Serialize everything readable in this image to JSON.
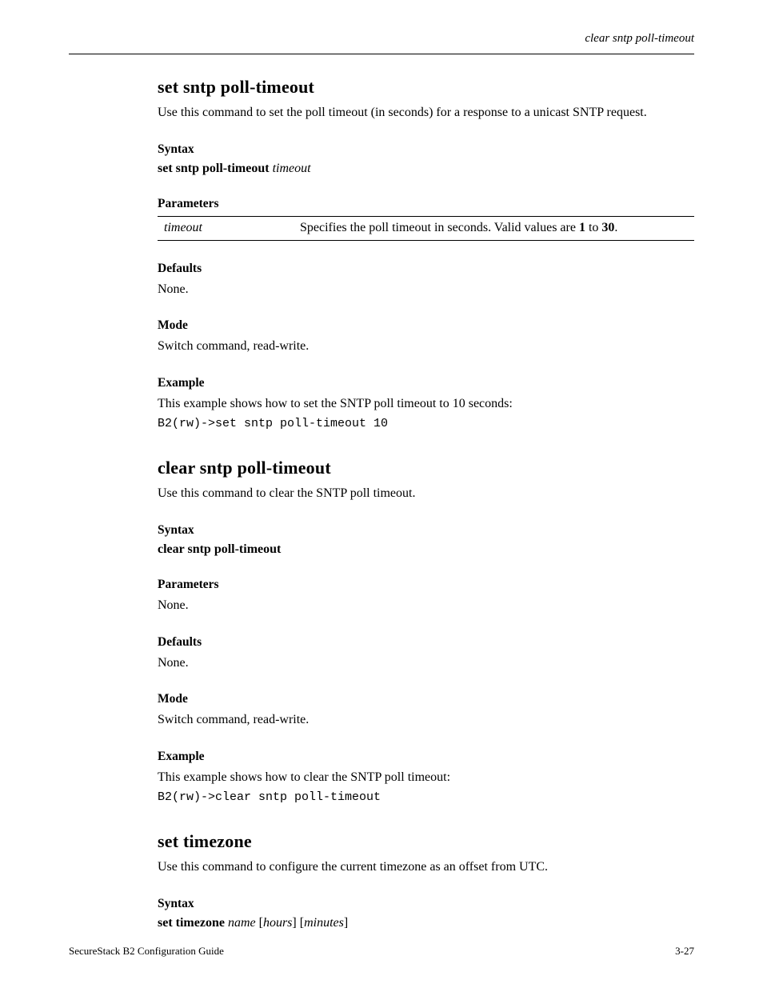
{
  "header": {
    "right": "clear sntp poll-timeout"
  },
  "sec1": {
    "title": "set sntp poll-timeout",
    "intro": "Use this command to set the poll timeout (in seconds) for a response to a unicast SNTP request.",
    "syntax_h": "Syntax",
    "syntax_cmd": "set sntp poll-timeout",
    "syntax_arg": "timeout",
    "params_h": "Parameters",
    "param_name": "timeout",
    "param_desc_pre": "Specifies the poll timeout in seconds. Valid values are ",
    "param_desc_b1": "1",
    "param_desc_mid": " to ",
    "param_desc_b2": "30",
    "param_desc_post": ".",
    "defaults_h": "Defaults",
    "defaults_v": "None.",
    "mode_h": "Mode",
    "mode_v": "Switch command, read‑write.",
    "example_h": "Example",
    "example_text": "This example shows how to set the SNTP poll timeout to 10 seconds:",
    "example_code": "B2(rw)->set sntp poll-timeout 10"
  },
  "sec2": {
    "title": "clear sntp poll-timeout",
    "intro": "Use this command to clear the SNTP poll timeout.",
    "syntax_h": "Syntax",
    "syntax_cmd": "clear sntp poll-timeout",
    "params_h": "Parameters",
    "params_v": "None.",
    "defaults_h": "Defaults",
    "defaults_v": "None.",
    "mode_h": "Mode",
    "mode_v": "Switch command, read‑write.",
    "example_h": "Example",
    "example_text": "This example shows how to clear the SNTP poll timeout:",
    "example_code": "B2(rw)->clear sntp poll-timeout"
  },
  "sec3": {
    "title": "set timezone",
    "intro": "Use this command to configure the current timezone as an offset from UTC.",
    "syntax_h": "Syntax",
    "syntax_cmd": "set timezone ",
    "syntax_arg1": "name",
    "syntax_opt1": " [",
    "syntax_arg2": "hours",
    "syntax_opt2": "] [",
    "syntax_arg3": "minutes",
    "syntax_opt3": "]"
  },
  "footer": {
    "left": "SecureStack B2 Configuration Guide",
    "right": "3-27"
  }
}
